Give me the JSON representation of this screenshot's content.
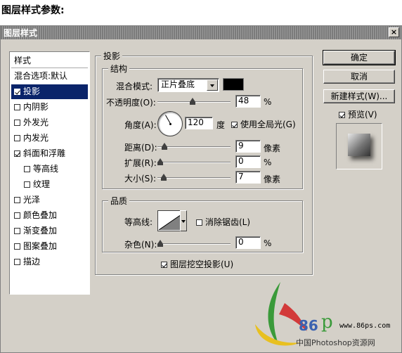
{
  "page_heading": "图层样式参数:",
  "dialog": {
    "title": "图层样式",
    "close_symbol": "×"
  },
  "sidebar": {
    "header": "样式",
    "blend_options": "混合选项:默认",
    "items": [
      {
        "label": "投影",
        "checked": true,
        "selected": true
      },
      {
        "label": "内阴影",
        "checked": false
      },
      {
        "label": "外发光",
        "checked": false
      },
      {
        "label": "内发光",
        "checked": false
      },
      {
        "label": "斜面和浮雕",
        "checked": true
      },
      {
        "label": "等高线",
        "checked": false,
        "indent": true
      },
      {
        "label": "纹理",
        "checked": false,
        "indent": true
      },
      {
        "label": "光泽",
        "checked": false
      },
      {
        "label": "颜色叠加",
        "checked": false
      },
      {
        "label": "渐变叠加",
        "checked": false
      },
      {
        "label": "图案叠加",
        "checked": false
      },
      {
        "label": "描边",
        "checked": false
      }
    ]
  },
  "drop_shadow": {
    "section_title": "投影",
    "structure_title": "结构",
    "blend_mode_label": "混合模式:",
    "blend_mode_value": "正片叠底",
    "shadow_color": "#000000",
    "opacity_label": "不透明度(O):",
    "opacity_value": "48",
    "opacity_unit": "%",
    "angle_label": "角度(A):",
    "angle_value": "120",
    "angle_unit": "度",
    "global_light_label": "使用全局光(G)",
    "global_light_checked": true,
    "distance_label": "距离(D):",
    "distance_value": "9",
    "distance_unit": "像素",
    "spread_label": "扩展(R):",
    "spread_value": "0",
    "spread_unit": "%",
    "size_label": "大小(S):",
    "size_value": "7",
    "size_unit": "像素",
    "quality_title": "品质",
    "contour_label": "等高线:",
    "antialias_label": "消除锯齿(L)",
    "antialias_checked": false,
    "noise_label": "杂色(N):",
    "noise_value": "0",
    "noise_unit": "%",
    "knockout_label": "图层挖空投影(U)",
    "knockout_checked": true
  },
  "buttons": {
    "ok": "确定",
    "cancel": "取消",
    "new_style": "新建样式(W)...",
    "preview_label": "预览(V)",
    "preview_checked": true
  },
  "watermark": {
    "site": "www.86ps.com",
    "name": "中国Photoshop资源网",
    "logo_text": "86"
  }
}
